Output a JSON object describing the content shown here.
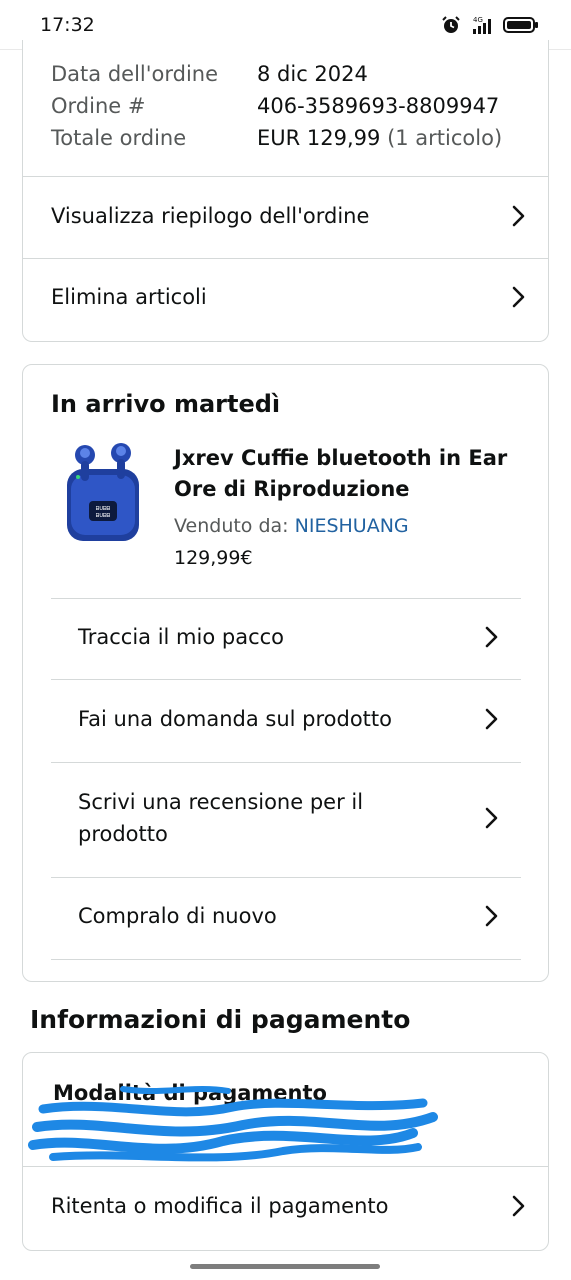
{
  "status_bar": {
    "time": "17:32",
    "icons": [
      "alarm-icon",
      "signal-4g-icon",
      "battery-icon"
    ],
    "network_label": "4G"
  },
  "order_summary": {
    "rows": [
      {
        "label": "Data dell'ordine",
        "value": "8 dic 2024"
      },
      {
        "label": "Ordine #",
        "value": "406-3589693-8809947"
      },
      {
        "label": "Totale ordine",
        "value": "EUR 129,99",
        "extra": "(1 articolo)"
      }
    ],
    "links": [
      {
        "label": "Visualizza riepilogo dell'ordine"
      },
      {
        "label": "Elimina articoli"
      }
    ]
  },
  "shipment": {
    "title": "In arrivo martedì",
    "product": {
      "image_icon": "earbuds-product-image",
      "title": "Jxrev Cuffie bluetooth in Ear Ore di Riproduzione",
      "seller_label": "Venduto da:",
      "seller_name": "NIESHUANG",
      "price": "129,99€"
    },
    "actions": [
      {
        "label": "Traccia il mio pacco"
      },
      {
        "label": "Fai una domanda sul prodotto"
      },
      {
        "label": "Scrivi una recensione per il prodotto"
      },
      {
        "label": "Compralo di nuovo"
      }
    ]
  },
  "payment": {
    "section_title": "Informazioni di pagamento",
    "method_title": "Modalità di pagamento",
    "retry_label": "Ritenta o modifica il pagamento"
  },
  "colors": {
    "link": "#2162a1",
    "text": "#0f1111",
    "muted": "#565959",
    "border": "#d5d9d9",
    "redaction": "#1e88e5"
  }
}
